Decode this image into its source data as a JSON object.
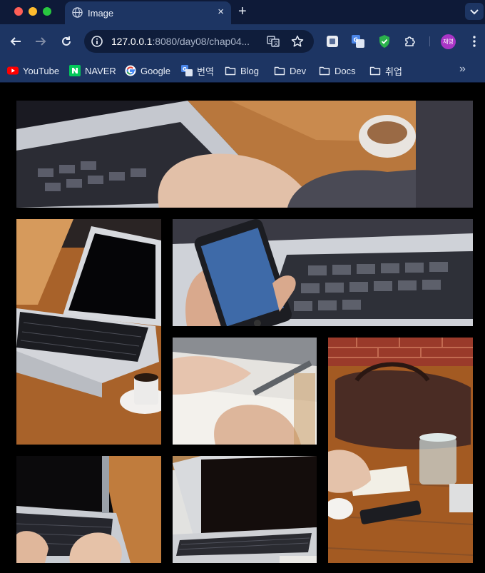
{
  "window": {
    "tab_title": "Image",
    "tab_favicon": "globe-icon",
    "new_tab_label": "+",
    "close_label": "×"
  },
  "toolbar": {
    "url_host": "127.0.0.1",
    "url_path": ":8080/day08/chap04...",
    "profile_label": "재영"
  },
  "bookmarks": [
    {
      "label": "YouTube",
      "icon": "youtube-icon"
    },
    {
      "label": "NAVER",
      "icon": "naver-icon"
    },
    {
      "label": "Google",
      "icon": "google-icon"
    },
    {
      "label": "번역",
      "icon": "translate-icon"
    },
    {
      "label": "Blog",
      "icon": "folder-icon"
    },
    {
      "label": "Dev",
      "icon": "folder-icon"
    },
    {
      "label": "Docs",
      "icon": "folder-icon"
    },
    {
      "label": "취업",
      "icon": "folder-icon"
    }
  ],
  "bookmarks_overflow": "»",
  "gallery": [
    {
      "subject": "hands typing on laptop keyboard"
    },
    {
      "subject": "open laptop with coffee cup on wooden table"
    },
    {
      "subject": "hand holding smartphone over laptop"
    },
    {
      "subject": "hand writing with pen on paper"
    },
    {
      "subject": "leather bag, glass of water, notebook and phone on table"
    },
    {
      "subject": "hands typing on laptop"
    },
    {
      "subject": "open laptop on white table"
    }
  ],
  "colors": {
    "tabbar_bg": "#0e1a38",
    "toolbar_bg": "#1d3563",
    "page_bg": "#000000",
    "wood": "#b06a2e",
    "laptop_silver": "#c8ccd2"
  }
}
